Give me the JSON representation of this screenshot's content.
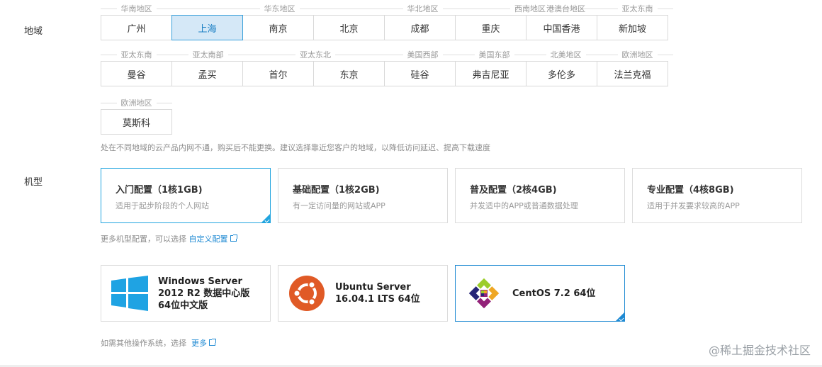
{
  "labels": {
    "region": "地域",
    "spec": "机型"
  },
  "regions": {
    "row1": {
      "headers": [
        {
          "text": "华南地区"
        },
        {
          "text": "华东地区"
        },
        {
          "text": "华北地区"
        },
        {
          "text": "西南地区"
        },
        {
          "text": "港澳台地区"
        },
        {
          "text": "亚太东南"
        }
      ],
      "cities": [
        "广州",
        "上海",
        "南京",
        "北京",
        "成都",
        "重庆",
        "中国香港",
        "新加坡"
      ],
      "selected": "上海"
    },
    "row2": {
      "headers": [
        {
          "text": "亚太东南"
        },
        {
          "text": "亚太南部"
        },
        {
          "text": "亚太东北"
        },
        {
          "text": "美国西部"
        },
        {
          "text": "美国东部"
        },
        {
          "text": "北美地区"
        },
        {
          "text": "欧洲地区"
        }
      ],
      "cities": [
        "曼谷",
        "孟买",
        "首尔",
        "东京",
        "硅谷",
        "弗吉尼亚",
        "多伦多",
        "法兰克福"
      ]
    },
    "row3": {
      "headers": [
        {
          "text": "欧洲地区"
        }
      ],
      "cities": [
        "莫斯科"
      ]
    },
    "hint": "处在不同地域的云产品内网不通，购买后不能更换。建议选择靠近您客户的地域，以降低访问延迟、提高下载速度"
  },
  "specs": [
    {
      "title": "入门配置（1核1GB)",
      "desc": "适用于起步阶段的个人网站",
      "selected": true
    },
    {
      "title": "基础配置（1核2GB)",
      "desc": "有一定访问量的网站或APP",
      "selected": false
    },
    {
      "title": "普及配置（2核4GB)",
      "desc": "并发适中的APP或普通数据处理",
      "selected": false
    },
    {
      "title": "专业配置（4核8GB)",
      "desc": "适用于并发要求较高的APP",
      "selected": false
    }
  ],
  "spec_hint": {
    "text": "更多机型配置，可以选择",
    "link": "自定义配置"
  },
  "os": [
    {
      "name": "Windows Server 2012 R2 数据中心版 64位中文版",
      "icon": "windows-icon",
      "selected": false
    },
    {
      "name": "Ubuntu Server 16.04.1 LTS 64位",
      "icon": "ubuntu-icon",
      "selected": false
    },
    {
      "name": "CentOS 7.2 64位",
      "icon": "centos-icon",
      "selected": true
    }
  ],
  "os_hint": {
    "text": "如需其他操作系统，选择",
    "link": "更多"
  },
  "watermark": "@稀土掘金技术社区",
  "colors": {
    "accent": "#1f8ad3",
    "selected_bg": "#d5e8f7",
    "windows": "#1fa3e3",
    "ubuntu": "#e05a26"
  }
}
